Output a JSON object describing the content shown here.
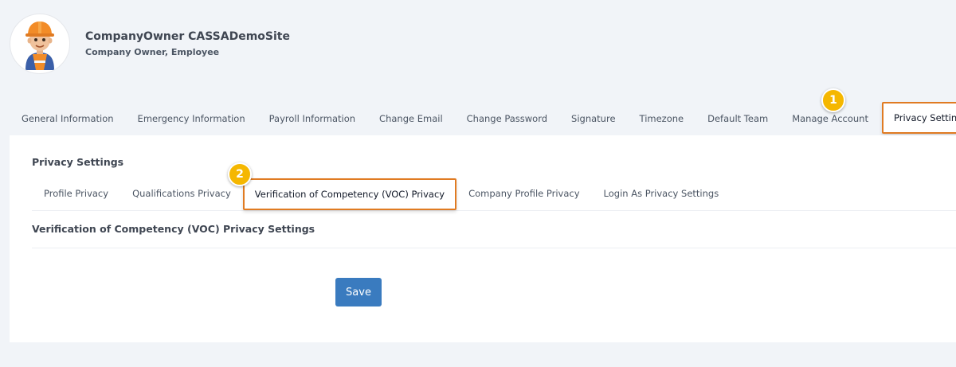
{
  "profile": {
    "name": "CompanyOwner CASSADemoSite",
    "role": "Company Owner, Employee",
    "avatar_icon": "construction-worker-avatar-icon"
  },
  "top_tabs": [
    {
      "label": "General Information",
      "active": false
    },
    {
      "label": "Emergency Information",
      "active": false
    },
    {
      "label": "Payroll Information",
      "active": false
    },
    {
      "label": "Change Email",
      "active": false
    },
    {
      "label": "Change Password",
      "active": false
    },
    {
      "label": "Signature",
      "active": false
    },
    {
      "label": "Timezone",
      "active": false
    },
    {
      "label": "Default Team",
      "active": false
    },
    {
      "label": "Manage Account",
      "active": false
    },
    {
      "label": "Privacy Settings",
      "active": true
    }
  ],
  "privacy": {
    "title": "Privacy Settings",
    "sub_tabs": [
      {
        "label": "Profile Privacy",
        "active": false
      },
      {
        "label": "Qualifications Privacy",
        "active": false
      },
      {
        "label": "Verification of Competency (VOC) Privacy",
        "active": true
      },
      {
        "label": "Company Profile Privacy",
        "active": false
      },
      {
        "label": "Login As Privacy Settings",
        "active": false
      }
    ],
    "section_title": "Verification of Competency (VOC) Privacy Settings",
    "save_label": "Save"
  },
  "badges": {
    "step1": "1",
    "step2": "2"
  },
  "colors": {
    "highlight_border": "#e07b22",
    "badge": "#f5b700",
    "save_button": "#3a7bbf",
    "page_background": "#f1f4f8"
  }
}
